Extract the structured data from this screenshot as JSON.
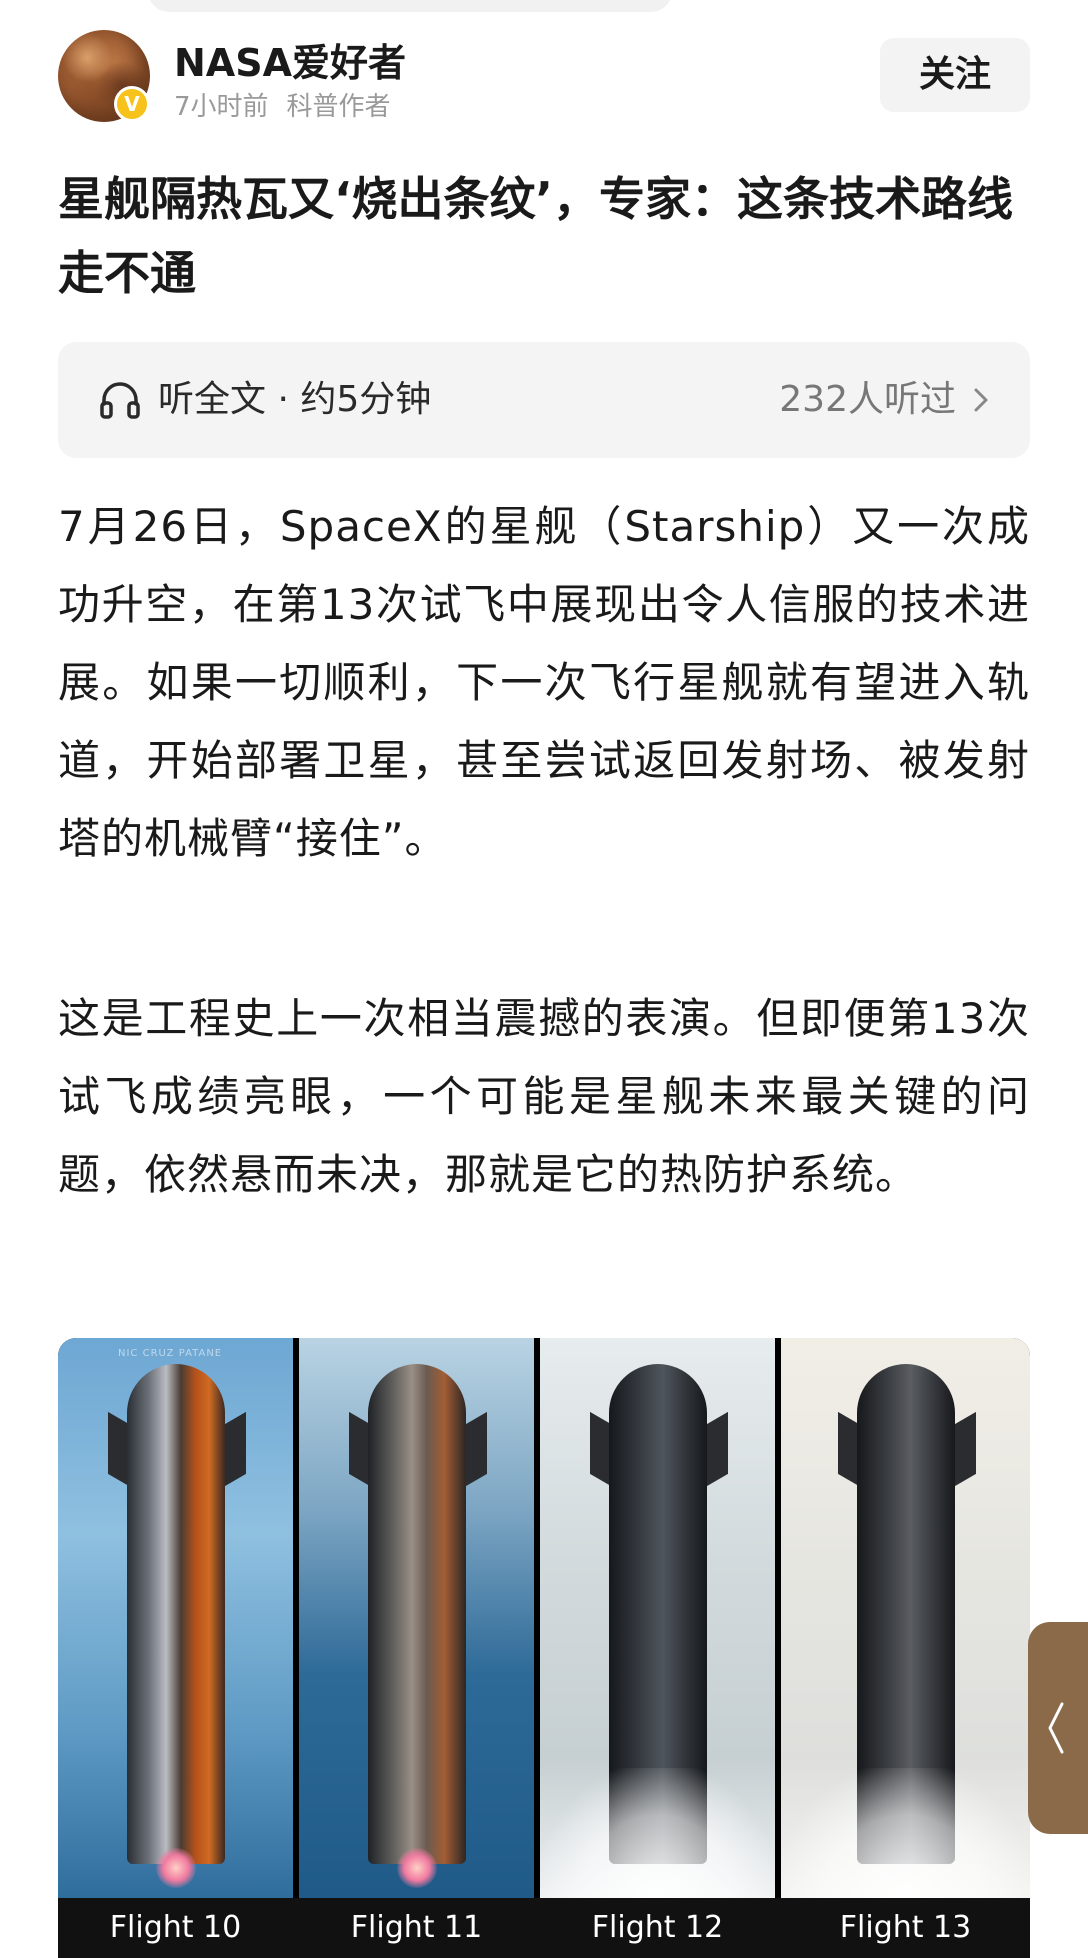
{
  "author": {
    "name": "NASA爱好者",
    "time": "7小时前",
    "role": "科普作者",
    "verified_badge": "V",
    "follow_label": "关注"
  },
  "article": {
    "title": "星舰隔热瓦又‘烧出条纹’，专家：这条技术路线走不通",
    "audio": {
      "label": "听全文 · 约5分钟",
      "listens": "232人听过"
    },
    "paragraphs": [
      "7月26日，SpaceX的星舰（Starship）又一次成功升空，在第13次试飞中展现出令人信服的技术进展。如果一切顺利，下一次飞行星舰就有望进入轨道，开始部署卫星，甚至尝试返回发射场、被发射塔的机械臂“接住”。",
      "这是工程史上一次相当震撼的表演。但即便第13次试飞成绩亮眼，一个可能是星舰未来最关键的问题，依然悬而未决，那就是它的热防护系统。"
    ],
    "figure": {
      "watermark": "NIC CRUZ PATANE",
      "captions": [
        "Flight 10",
        "Flight 11",
        "Flight 12",
        "Flight 13"
      ]
    }
  },
  "colors": {
    "badge": "#f6c21b",
    "side_handle": "#8b6a4a",
    "muted_text": "#9a9a9a"
  },
  "icons": {
    "audio": "headphones-icon",
    "more": "chevron-right-icon",
    "side": "chevron-left-icon"
  }
}
